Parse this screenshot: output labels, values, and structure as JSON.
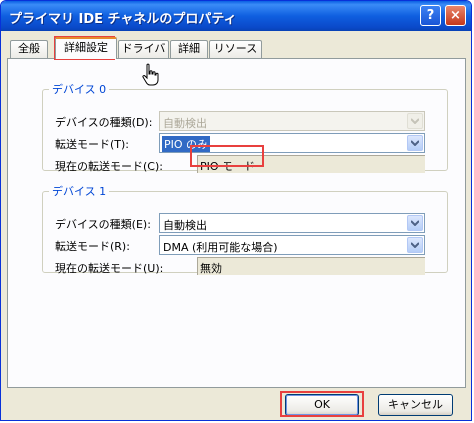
{
  "window": {
    "title": "プライマリ IDE チャネルのプロパティ"
  },
  "titlebar": {
    "help_label": "?",
    "close_label": "×"
  },
  "tabs": [
    {
      "label": "全般"
    },
    {
      "label": "詳細設定"
    },
    {
      "label": "ドライバ"
    },
    {
      "label": "詳細"
    },
    {
      "label": "リソース"
    }
  ],
  "device0": {
    "title": "デバイス 0",
    "type_label": "デバイスの種類(D):",
    "type_value": "自動検出",
    "mode_label": "転送モード(T):",
    "mode_value": "PIO のみ",
    "current_label": "現在の転送モード(C):",
    "current_value": "PIO モード"
  },
  "device1": {
    "title": "デバイス 1",
    "type_label": "デバイスの種類(E):",
    "type_value": "自動検出",
    "mode_label": "転送モード(R):",
    "mode_value": "DMA (利用可能な場合)",
    "current_label": "現在の転送モード(U):",
    "current_value": "無効"
  },
  "buttons": {
    "ok": "OK",
    "cancel": "キャンセル"
  },
  "colors": {
    "highlight": "#e8403e",
    "selection": "#316ac5",
    "group_title": "#0046d5"
  },
  "icons": {
    "cursor": "hand-pointer-icon",
    "dropdown": "chevron-down-icon"
  }
}
